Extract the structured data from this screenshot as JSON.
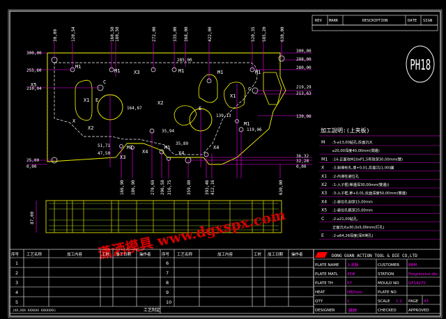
{
  "revision_header": {
    "rev": "REV",
    "mark": "MARK",
    "description": "DESCRIPTION",
    "date": "DATE",
    "sign": "SIGN"
  },
  "drawing_no": "PH18",
  "left_dims": [
    "300,00",
    "255,60",
    "210,04",
    "25,00",
    "0,00"
  ],
  "right_dims": [
    "300,00",
    "288,00",
    "280,00",
    "219,29",
    "213,63",
    "139,06",
    "36,32",
    "32,28",
    "0,00"
  ],
  "top_dims": [
    "30,00",
    "120,54",
    "160,50",
    "180,50",
    "272,00",
    "335,00",
    "368,00",
    "422,00",
    "520,35",
    "585,20",
    "630,00"
  ],
  "bottom_dims": [
    "166,90",
    "186,90",
    "270,69",
    "296,58",
    "316,75",
    "359,80",
    "393,46",
    "412,16",
    "630,00"
  ],
  "inner_dims": [
    "285,00",
    "164,67",
    "35,94",
    "51,71",
    "47,50",
    "35,89",
    "139,13",
    "119,06",
    "87,00"
  ],
  "part_labels": [
    "M1",
    "M1",
    "X3",
    "X5",
    "M1",
    "X2",
    "M1",
    "C",
    "E",
    "X1",
    "X",
    "X2",
    "X3",
    "X4",
    "E",
    "C",
    "M1",
    "X1",
    "M1",
    "X4",
    "X4",
    "M1",
    "M1"
  ],
  "watermark": "潇洒模具 www.dgxspx.com",
  "notes": {
    "title": "加工說明:(上夹板)",
    "rows": [
      {
        "code": "M",
        "text": ":5-⌀13,00鉆孔,反面沉大"
      },
      {
        "code": "",
        "text": "⌀20,00深度40,00mm(側邊)"
      },
      {
        "code": "M1",
        "text": ":14-正面攻M10xP1,5有效深30,00mm(雙)"
      },
      {
        "code": "X",
        "text": ":3-割導柱孔,單+0,01,反面沉(1,00)圓"
      },
      {
        "code": "X1",
        "text": ":2-內導柱避位孔"
      },
      {
        "code": "X2",
        "text": ":1-入子框(單邊深30,00mm(雙邊))"
      },
      {
        "code": "X3",
        "text": ":3-入子框,單+0,01,反面深度50,00mm(雙邊)"
      },
      {
        "code": "X4",
        "text": ":2-避位孔割深15,00mm"
      },
      {
        "code": "X5",
        "text": ":1-避位孔銑深25,00mm"
      },
      {
        "code": "C",
        "text": ":2-⌀21,00鉆孔,"
      },
      {
        "code": "",
        "text": "正面沉大⌀30,0x5,00mm(打孔)"
      },
      {
        "code": "E",
        "text": ":2-⌀64,26深度(深R彎孔)"
      }
    ]
  },
  "process_table_left": {
    "headers": [
      "序号",
      "工艺名称",
      "加工内容",
      "工时",
      "加工日期",
      "操作者"
    ],
    "rows": [
      "1",
      "2",
      "3",
      "4",
      "5"
    ],
    "footer": "(XX,XXX XXXXXX XXXXXXX)"
  },
  "process_table_right": {
    "headers": [
      "序号",
      "工艺名称",
      "加工内容",
      "工时",
      "加工日期",
      "操作者"
    ],
    "rows": [
      "6",
      "7",
      "8",
      "9",
      "10"
    ],
    "footer": "工艺制定"
  },
  "title_block": {
    "company": "DONG GUAN ACTION TOOL & DIE CO,LTD",
    "rows": [
      [
        {
          "label": "PLATE NAME",
          "value": "上夹板"
        },
        {
          "label": "CUSTOMER",
          "value": "BBM"
        }
      ],
      [
        {
          "label": "PLATE MATL",
          "value": "45#"
        },
        {
          "label": "STATION",
          "value": "Progressive die"
        }
      ],
      [
        {
          "label": "PLATE TH",
          "value": "57"
        },
        {
          "label": "MOULD NO",
          "value": "GF14270"
        }
      ],
      [
        {
          "label": "HEAT",
          "value": "HRDxxx"
        },
        {
          "label": "PLATE NO",
          "value": ""
        }
      ],
      [
        {
          "label": "QTY",
          "value": "1"
        },
        {
          "label": "SCALE",
          "value": "1:1"
        },
        {
          "label": "PAGE",
          "value": "43"
        }
      ],
      [
        {
          "label": "DESIGNER",
          "value": ""
        },
        {
          "label": "CHECKED",
          "value": ""
        },
        {
          "label": "APPROVED",
          "value": ""
        }
      ]
    ],
    "designer_name": "薛婷"
  },
  "colors": {
    "frame": "#ffffff",
    "outline": "#ffff00",
    "dims": "#ff00ff",
    "labels": "#ffffff",
    "bands": "#9acd32",
    "hatch": "#ffff00",
    "watermark": "#d40000"
  }
}
